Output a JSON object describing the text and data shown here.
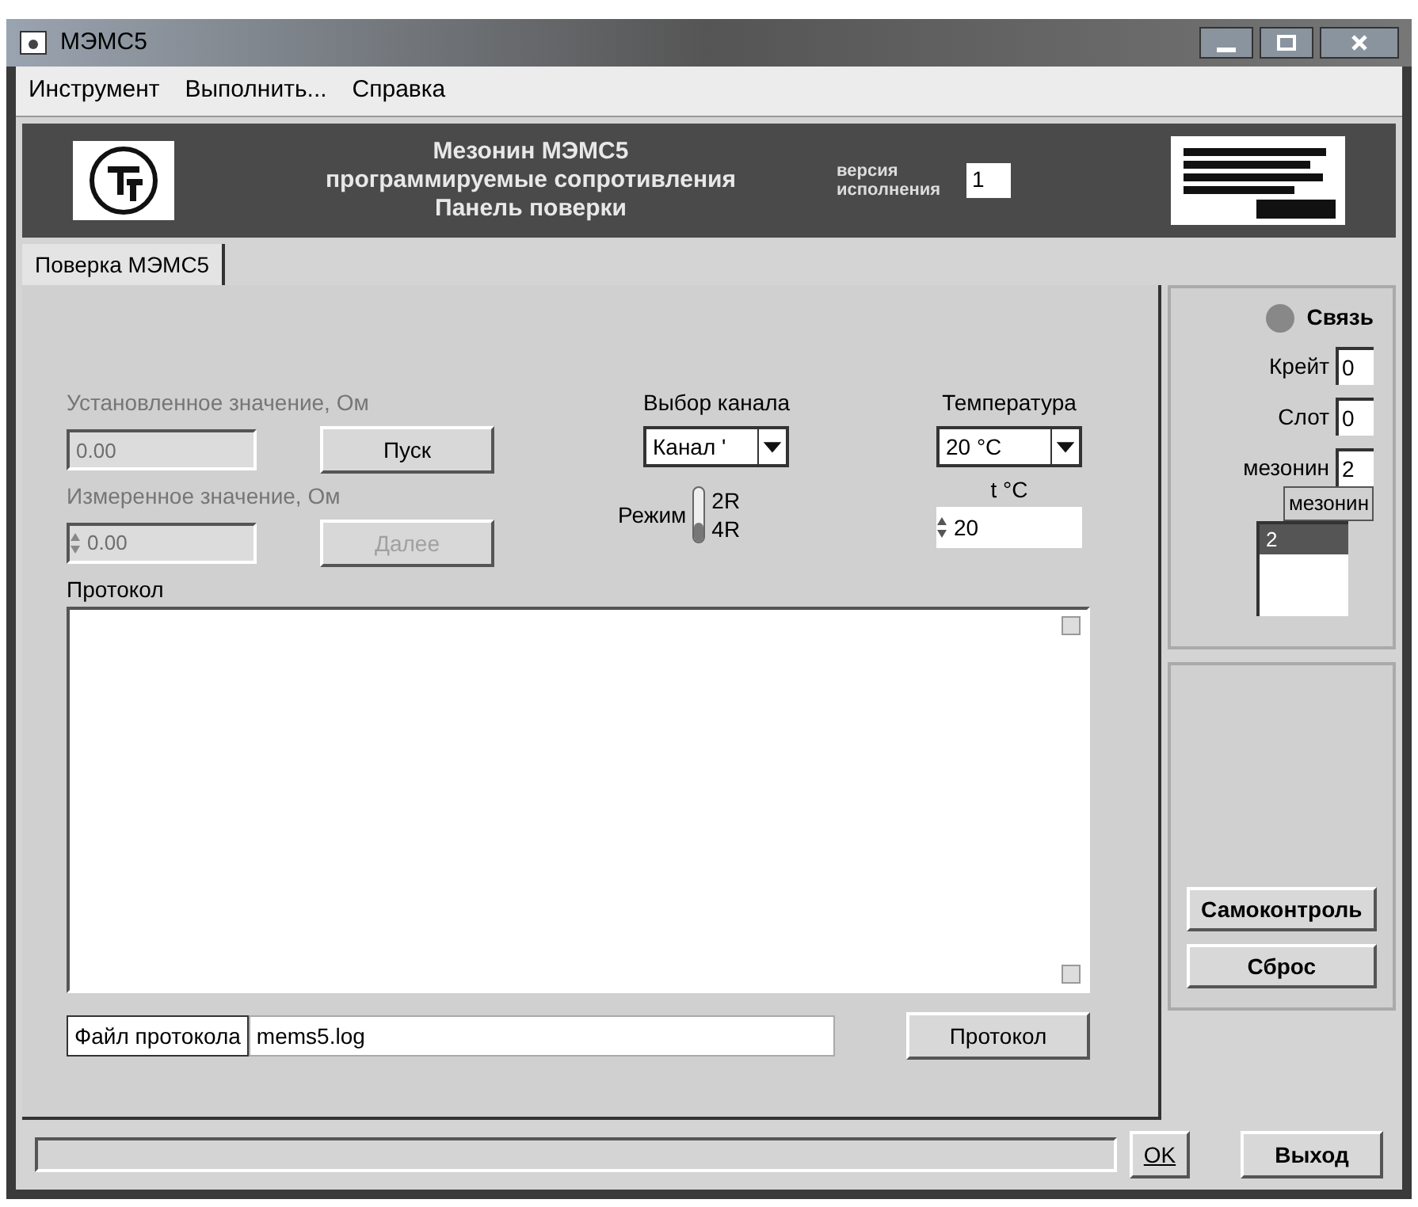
{
  "window": {
    "title": "МЭМС5"
  },
  "menu": [
    {
      "label": "Инструмент"
    },
    {
      "label": "Выполнить..."
    },
    {
      "label": "Справка"
    }
  ],
  "banner": {
    "title_lines": [
      "Мезонин МЭМС5",
      "программируемые сопротивления",
      "Панель поверки"
    ],
    "version_label_lines": [
      "версия",
      "исполнения"
    ],
    "version": "1"
  },
  "tabs": [
    {
      "label": "Поверка МЭМС5",
      "selected": true
    }
  ],
  "set_value": {
    "label": "Установленное значение, Ом",
    "value": "0.00",
    "disabled": true
  },
  "start_button": {
    "label": "Пуск",
    "disabled": false
  },
  "measured_value": {
    "label": "Измеренное значение, Ом",
    "value": "0.00",
    "disabled": true
  },
  "next_button": {
    "label": "Далее",
    "disabled": true
  },
  "channel": {
    "label": "Выбор канала",
    "value": "Канал '"
  },
  "mode": {
    "label": "Режим",
    "switch_down": true,
    "options": [
      {
        "label": "2R"
      },
      {
        "label": "4R"
      }
    ]
  },
  "temperature": {
    "label": "Температура",
    "value": "20 °C"
  },
  "temperature_input": {
    "label": "t °C",
    "value": "20"
  },
  "protocol": {
    "label": "Протокол"
  },
  "file": {
    "label": "Файл протокола",
    "value": "mems5.log",
    "button": "Протокол"
  },
  "connection": {
    "label": "Связь",
    "on": false
  },
  "address_fields": [
    {
      "label": "Крейт",
      "value": "0"
    },
    {
      "label": "Слот",
      "value": "0"
    },
    {
      "label": "мезонин",
      "value": "2"
    }
  ],
  "mezzanine_list": {
    "header": "мезонин",
    "items": [
      {
        "label": "2",
        "selected": true
      }
    ]
  },
  "side_buttons": [
    {
      "label": "Самоконтроль"
    },
    {
      "label": "Сброс"
    }
  ],
  "status_bar": {
    "ok_button": "OK",
    "exit_button": "Выход"
  }
}
